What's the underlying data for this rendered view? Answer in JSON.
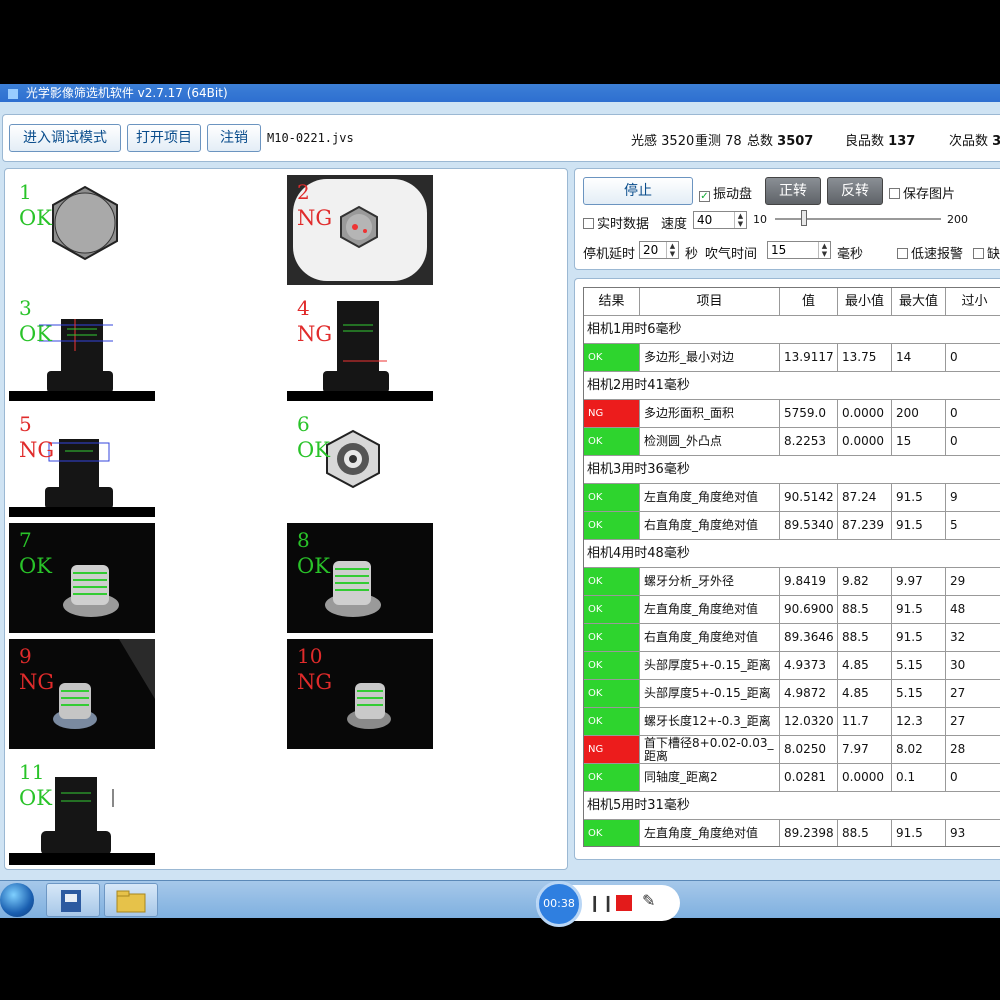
{
  "window": {
    "title": "光学影像筛选机软件 v2.7.17 (64Bit)"
  },
  "toolbar": {
    "debug_label": "进入调试模式",
    "open_label": "打开项目",
    "logout_label": "注销",
    "project_file": "M10-0221.jvs",
    "stats": {
      "sensor_label": "光感",
      "sensor_value": "3520",
      "retest_label": "重测",
      "retest_value": "78",
      "total_label": "总数",
      "total_value": "3507",
      "good_label": "良品数",
      "good_value": "137",
      "defect_label": "次品数",
      "defect_value": "3"
    }
  },
  "cameras": [
    {
      "num": "1",
      "result": "OK"
    },
    {
      "num": "2",
      "result": "NG"
    },
    {
      "num": "3",
      "result": "OK"
    },
    {
      "num": "4",
      "result": "NG"
    },
    {
      "num": "5",
      "result": "NG"
    },
    {
      "num": "6",
      "result": "OK"
    },
    {
      "num": "7",
      "result": "OK"
    },
    {
      "num": "8",
      "result": "OK"
    },
    {
      "num": "9",
      "result": "NG"
    },
    {
      "num": "10",
      "result": "NG"
    },
    {
      "num": "11",
      "result": "OK"
    }
  ],
  "controls": {
    "stop_label": "停止",
    "vibration_label": "振动盘",
    "vibration_checked": true,
    "forward_label": "正转",
    "reverse_label": "反转",
    "save_image_label": "保存图片",
    "realtime_label": "实时数据",
    "speed_label": "速度",
    "speed_value": "40",
    "slider_min": "10",
    "slider_max": "200",
    "stop_delay_label": "停机延时",
    "stop_delay_value": "20",
    "seconds_label": "秒",
    "blow_time_label": "吹气时间",
    "blow_time_value": "15",
    "ms_label": "毫秒",
    "low_speed_alarm_label": "低速报警",
    "extra_label": "缺"
  },
  "table": {
    "headers": [
      "结果",
      "项目",
      "值",
      "最小值",
      "最大值",
      "过小"
    ],
    "rows": [
      {
        "type": "group",
        "label": "相机1用时6毫秒"
      },
      {
        "type": "item",
        "result": "OK",
        "item": "多边形_最小对边",
        "value": "13.9117",
        "min": "13.75",
        "max": "14",
        "small": "0"
      },
      {
        "type": "group",
        "label": "相机2用时41毫秒"
      },
      {
        "type": "item",
        "result": "NG",
        "item": "多边形面积_面积",
        "value": "5759.0",
        "min": "0.0000",
        "max": "200",
        "small": "0"
      },
      {
        "type": "item",
        "result": "OK",
        "item": "检测圆_外凸点",
        "value": "8.2253",
        "min": "0.0000",
        "max": "15",
        "small": "0"
      },
      {
        "type": "group",
        "label": "相机3用时36毫秒"
      },
      {
        "type": "item",
        "result": "OK",
        "item": "左直角度_角度绝对值",
        "value": "90.5142",
        "min": "87.24",
        "max": "91.5",
        "small": "9"
      },
      {
        "type": "item",
        "result": "OK",
        "item": "右直角度_角度绝对值",
        "value": "89.5340",
        "min": "87.239",
        "max": "91.5",
        "small": "5"
      },
      {
        "type": "group",
        "label": "相机4用时48毫秒"
      },
      {
        "type": "item",
        "result": "OK",
        "item": "螺牙分析_牙外径",
        "value": "9.8419",
        "min": "9.82",
        "max": "9.97",
        "small": "29"
      },
      {
        "type": "item",
        "result": "OK",
        "item": "左直角度_角度绝对值",
        "value": "90.6900",
        "min": "88.5",
        "max": "91.5",
        "small": "48"
      },
      {
        "type": "item",
        "result": "OK",
        "item": "右直角度_角度绝对值",
        "value": "89.3646",
        "min": "88.5",
        "max": "91.5",
        "small": "32"
      },
      {
        "type": "item",
        "result": "OK",
        "item": "头部厚度5+-0.15_距离",
        "value": "4.9373",
        "min": "4.85",
        "max": "5.15",
        "small": "30"
      },
      {
        "type": "item",
        "result": "OK",
        "item": "头部厚度5+-0.15_距离",
        "value": "4.9872",
        "min": "4.85",
        "max": "5.15",
        "small": "27"
      },
      {
        "type": "item",
        "result": "OK",
        "item": "螺牙长度12+-0.3_距离",
        "value": "12.0320",
        "min": "11.7",
        "max": "12.3",
        "small": "27"
      },
      {
        "type": "item",
        "result": "NG",
        "item": "首下槽径8+0.02-0.03_距离",
        "value": "8.0250",
        "min": "7.97",
        "max": "8.02",
        "small": "28",
        "wrap": true
      },
      {
        "type": "item",
        "result": "OK",
        "item": "同轴度_距离2",
        "value": "0.0281",
        "min": "0.0000",
        "max": "0.1",
        "small": "0"
      },
      {
        "type": "group",
        "label": "相机5用时31毫秒"
      },
      {
        "type": "item",
        "result": "OK",
        "item": "左直角度_角度绝对值",
        "value": "89.2398",
        "min": "88.5",
        "max": "91.5",
        "small": "93"
      }
    ]
  },
  "taskbar": {
    "recorder_time": "00:38"
  }
}
